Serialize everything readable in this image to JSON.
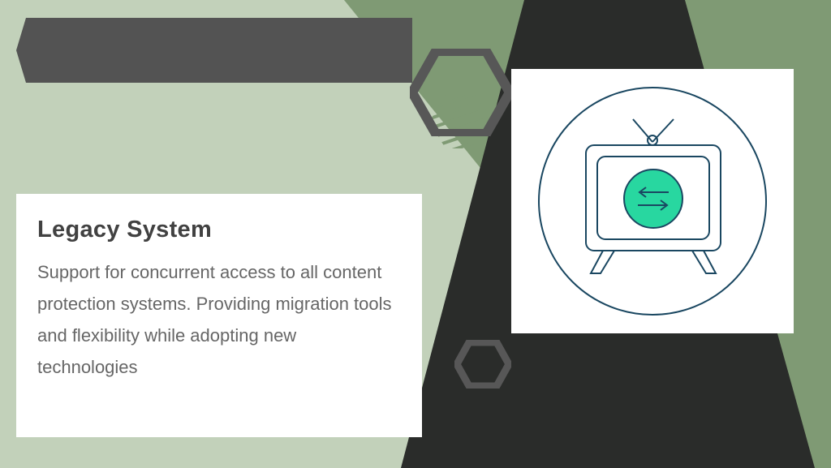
{
  "card": {
    "title": "Legacy System",
    "body": "Support for concurrent access to all content protection systems. Providing migration tools and flexibility while adopting new technologies"
  },
  "colors": {
    "page_bg": "#c2d1ba",
    "header_bar": "#535353",
    "card_bg": "#ffffff",
    "title_color": "#414141",
    "body_color": "#666666",
    "icon_stroke": "#1a4761",
    "icon_accent": "#28d7a0",
    "hex_stroke": "#575757",
    "bg_green": "#7f9a74",
    "bg_black": "#2a2c2a"
  },
  "icons": {
    "hero": "tv-transfer-icon",
    "hex_large": "hexagon-outline-icon",
    "hex_small": "hexagon-outline-icon",
    "stripes": "diagonal-stripes-pattern"
  }
}
